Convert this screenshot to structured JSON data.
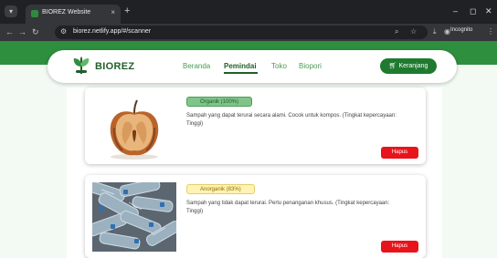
{
  "browser": {
    "tab_title": "BIOREZ Website",
    "tab_close": "×",
    "new_tab": "+",
    "menu_glyph": "▾",
    "url": "biorez.netlify.app/#/scanner",
    "profile_label": "Incognito",
    "window_controls": {
      "minimize": "–",
      "maximize": "◻",
      "close": "✕"
    },
    "icons": [
      "back-arrow-icon",
      "forward-arrow-icon",
      "reload-icon",
      "site-settings-icon",
      "zoom-icon",
      "bookmark-star-icon",
      "download-icon",
      "incognito-icon",
      "more-menu-icon"
    ]
  },
  "navbar": {
    "brand": "BIOREZ",
    "links": [
      {
        "label": "Beranda",
        "active": false
      },
      {
        "label": "Pemindai",
        "active": true
      },
      {
        "label": "Toko",
        "active": false
      },
      {
        "label": "Biopori",
        "active": false
      }
    ],
    "cart_label": "Keranjang"
  },
  "results": [
    {
      "image": "rotten apple",
      "badge": "Organik (100%)",
      "type": "organic",
      "description": "Sampah yang dapat terurai secara alami. Cocok untuk kompos. (Tingkat kepercayaan: Tinggi)",
      "delete_label": "Hapus"
    },
    {
      "image": "plastic bottles",
      "badge": "Anorganik (83%)",
      "type": "anorganic",
      "description": "Sampah yang tidak dapat terurai. Perlu penanganan khusus. (Tingkat kepercayaan: Tinggi)",
      "delete_label": "Hapus"
    }
  ],
  "colors": {
    "brand_green": "#2e8f3e",
    "dark_green": "#1f5f2a",
    "organic_badge": "#7fc58a",
    "anorganic_badge": "#fff3b5",
    "delete_red": "#e8141b"
  }
}
